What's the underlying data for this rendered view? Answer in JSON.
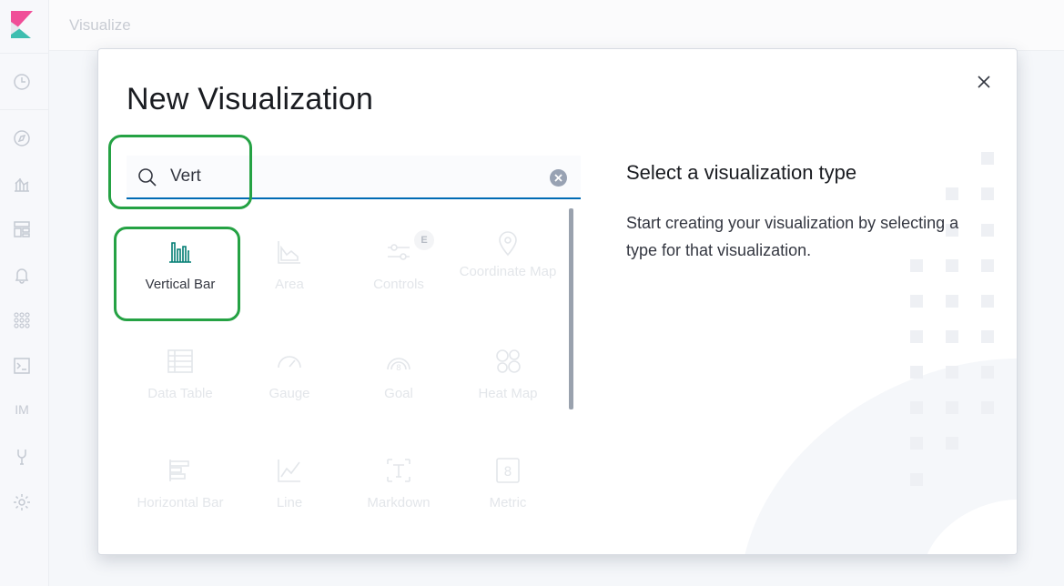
{
  "header": {
    "app_title": "Visualize"
  },
  "sidenav": {
    "items": [
      {
        "icon": "clock-icon"
      },
      {
        "icon": "compass-icon"
      },
      {
        "icon": "chart-icon"
      },
      {
        "icon": "dashboard-icon"
      },
      {
        "icon": "bell-icon"
      },
      {
        "icon": "apps-icon"
      },
      {
        "icon": "console-icon"
      },
      {
        "label": "IM"
      },
      {
        "icon": "wrench-icon"
      },
      {
        "icon": "gear-icon"
      }
    ]
  },
  "modal": {
    "title": "New Visualization",
    "search": {
      "value": "Vert"
    },
    "types": [
      {
        "label": "Vertical Bar",
        "icon": "vertical-bar-icon",
        "enabled": true
      },
      {
        "label": "Area",
        "icon": "area-chart-icon",
        "enabled": false
      },
      {
        "label": "Controls",
        "icon": "controls-icon",
        "enabled": false,
        "badge": "E"
      },
      {
        "label": "Coordinate Map",
        "icon": "map-pin-icon",
        "enabled": false
      },
      {
        "label": "Data Table",
        "icon": "table-icon",
        "enabled": false
      },
      {
        "label": "Gauge",
        "icon": "gauge-icon",
        "enabled": false
      },
      {
        "label": "Goal",
        "icon": "goal-icon",
        "enabled": false
      },
      {
        "label": "Heat Map",
        "icon": "heatmap-icon",
        "enabled": false
      },
      {
        "label": "Horizontal Bar",
        "icon": "horizontal-bar-icon",
        "enabled": false
      },
      {
        "label": "Line",
        "icon": "line-chart-icon",
        "enabled": false
      },
      {
        "label": "Markdown",
        "icon": "markdown-icon",
        "enabled": false
      },
      {
        "label": "Metric",
        "icon": "metric-icon",
        "enabled": false
      }
    ],
    "description": {
      "title": "Select a visualization type",
      "text": "Start creating your visualization by selecting a type for that visualization."
    }
  },
  "colors": {
    "accent": "#006bb4",
    "highlight": "#25a244",
    "active_icon": "#017d73"
  }
}
